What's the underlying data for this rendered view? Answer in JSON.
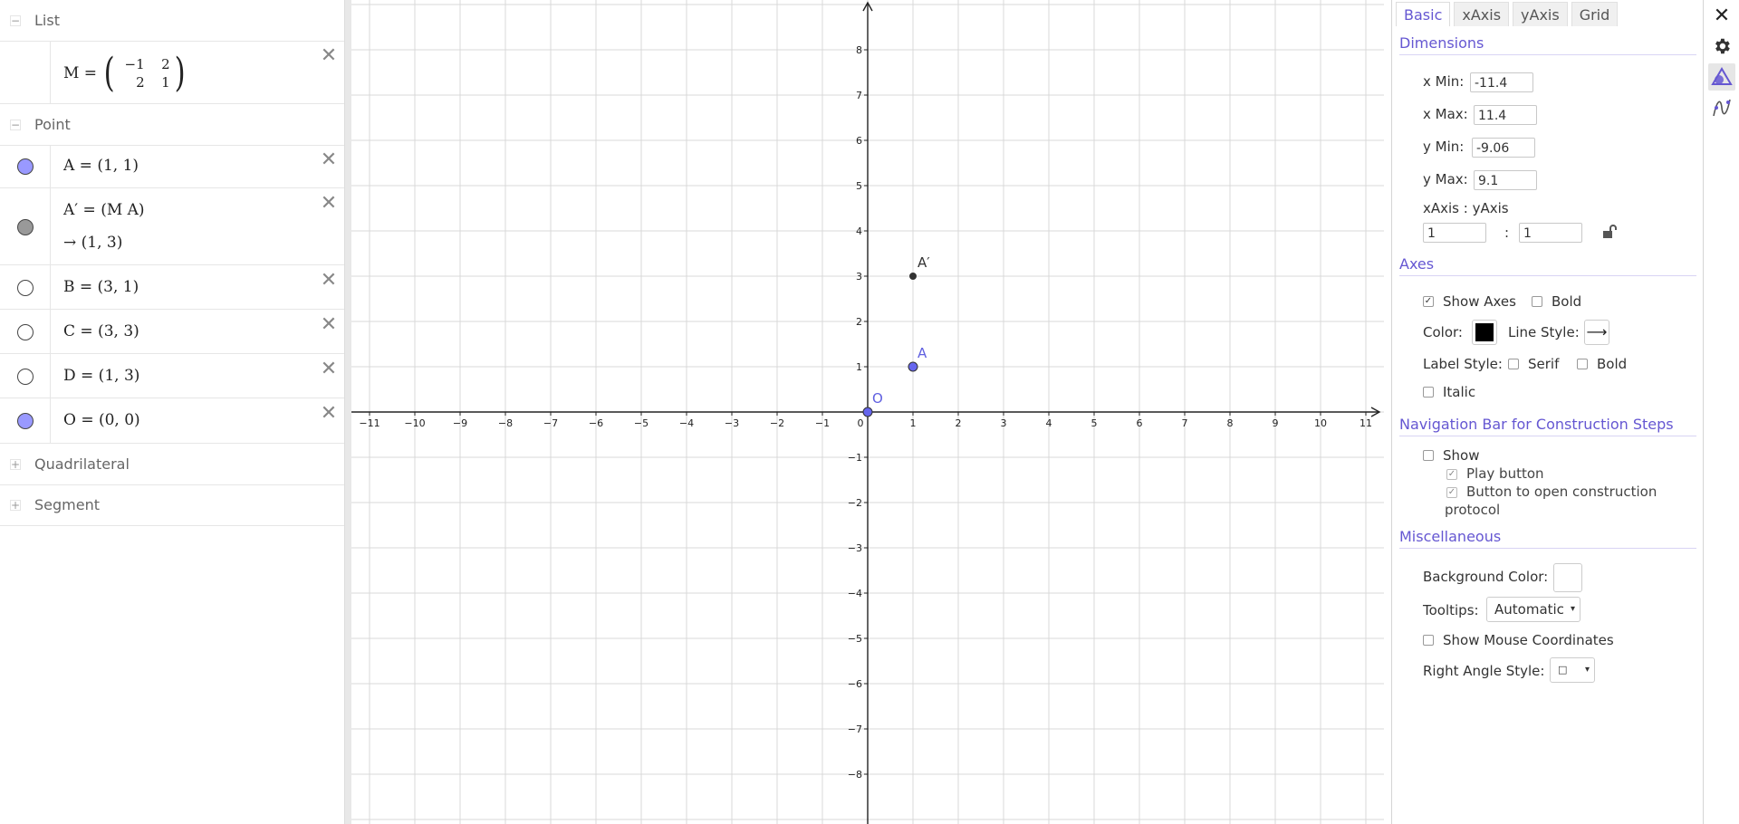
{
  "algebra": {
    "groups": {
      "list": "List",
      "point": "Point",
      "quadrilateral": "Quadrilateral",
      "segment": "Segment"
    },
    "matrix_name": "M =",
    "matrix": {
      "r0c0": "−1",
      "r0c1": "2",
      "r1c0": "2",
      "r1c1": "1"
    },
    "points": [
      {
        "text": "A = (1, 1)",
        "color": "#9999ff",
        "filled": true
      },
      {
        "text": "A′ = (M A)",
        "result": "→  (1, 3)",
        "color": "#999999",
        "filled": true
      },
      {
        "text": "B = (3, 1)",
        "color": "#ffffff",
        "filled": false
      },
      {
        "text": "C = (3, 3)",
        "color": "#ffffff",
        "filled": false
      },
      {
        "text": "D = (1, 3)",
        "color": "#ffffff",
        "filled": false
      },
      {
        "text": "O = (0, 0)",
        "color": "#9999ff",
        "filled": true
      }
    ],
    "collapse_sym": "−",
    "expand_sym": "+",
    "delete_sym": "✕"
  },
  "graphics": {
    "x_ticks": [
      "−11",
      "−10",
      "−9",
      "−8",
      "−7",
      "−6",
      "−5",
      "−4",
      "−3",
      "−2",
      "−1",
      "0",
      "1",
      "2",
      "3",
      "4",
      "5",
      "6",
      "7",
      "8",
      "9",
      "10",
      "11"
    ],
    "y_ticks_pos": [
      "1",
      "2",
      "3",
      "4",
      "5",
      "6",
      "7",
      "8"
    ],
    "y_ticks_neg": [
      "−1",
      "−2",
      "−3",
      "−4",
      "−5",
      "−6",
      "−7",
      "−8"
    ],
    "points": [
      {
        "label": "A′",
        "x": 1,
        "y": 3,
        "color": "#333333",
        "label_color": "#333333"
      },
      {
        "label": "A",
        "x": 1,
        "y": 1,
        "color": "#6666ee",
        "label_color": "#6060e0"
      },
      {
        "label": "O",
        "x": 0,
        "y": 0,
        "color": "#6666ee",
        "label_color": "#6060e0"
      }
    ]
  },
  "settings": {
    "tabs": [
      "Basic",
      "xAxis",
      "yAxis",
      "Grid"
    ],
    "dimensions": {
      "title": "Dimensions",
      "xmin_label": "x Min:",
      "xmin": "-11.4",
      "xmax_label": "x Max:",
      "xmax": "11.4",
      "ymin_label": "y Min:",
      "ymin": "-9.06",
      "ymax_label": "y Max:",
      "ymax": "9.1",
      "ratio_label": "xAxis : yAxis",
      "ratio_x": "1",
      "ratio_sep": ":",
      "ratio_y": "1"
    },
    "axes": {
      "title": "Axes",
      "show_axes": "Show Axes",
      "bold": "Bold",
      "color_label": "Color:",
      "color": "#000000",
      "line_style_label": "Line Style:",
      "line_style_glyph": "⟶",
      "label_style": "Label Style:",
      "serif": "Serif",
      "bold2": "Bold",
      "italic": "Italic"
    },
    "navbar": {
      "title": "Navigation Bar for Construction Steps",
      "show": "Show",
      "play": "Play button",
      "protocol_1": "Button to open construction",
      "protocol_2": "protocol"
    },
    "misc": {
      "title": "Miscellaneous",
      "bg_color_label": "Background Color:",
      "tooltips_label": "Tooltips:",
      "tooltips_value": "Automatic",
      "mouse_coords": "Show Mouse Coordinates",
      "right_angle_label": "Right Angle Style:",
      "right_angle_value": "□"
    },
    "check_glyph": "✓",
    "dropdown_arrow": "▾"
  },
  "strip": {
    "close_sym": "✕"
  }
}
